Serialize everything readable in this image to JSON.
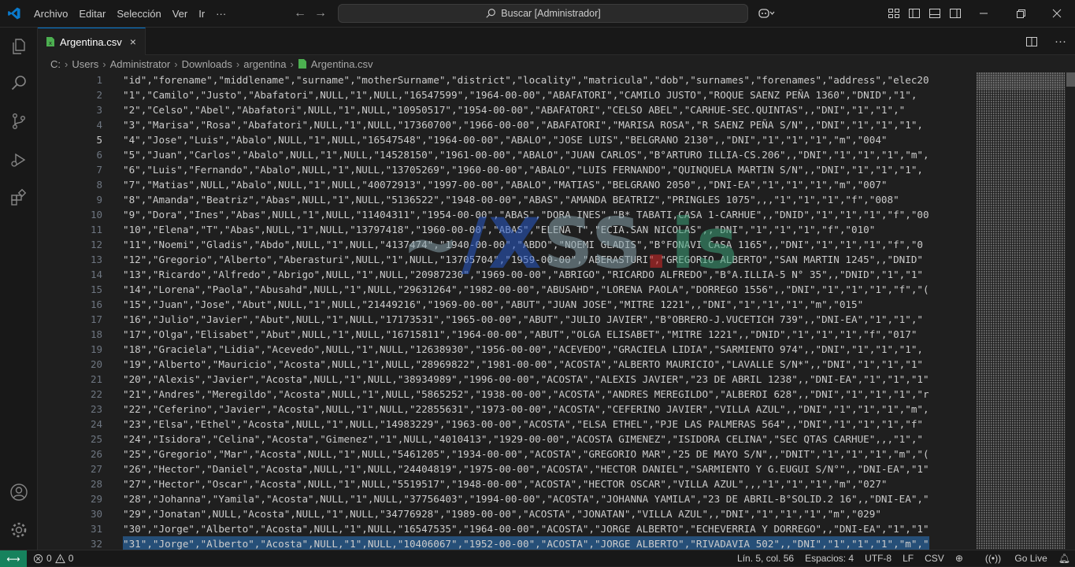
{
  "menu": [
    "Archivo",
    "Editar",
    "Selección",
    "Ver",
    "Ir",
    "···"
  ],
  "search_label": "Buscar [Administrador]",
  "tab_label": "Argentina.csv",
  "tab_close": "×",
  "breadcrumb": [
    "C:",
    "Users",
    "Administrator",
    "Downloads",
    "argentina",
    "Argentina.csv"
  ],
  "active_line": 5,
  "line_numbers": [
    "1",
    "2",
    "3",
    "4",
    "5",
    "6",
    "7",
    "8",
    "9",
    "10",
    "11",
    "12",
    "13",
    "14",
    "15",
    "16",
    "17",
    "18",
    "19",
    "20",
    "21",
    "22",
    "23",
    "24",
    "25",
    "26",
    "27",
    "28",
    "29",
    "30",
    "31",
    "32"
  ],
  "lines": [
    "\"id\",\"forename\",\"middlename\",\"surname\",\"motherSurname\",\"district\",\"locality\",\"matricula\",\"dob\",\"surnames\",\"forenames\",\"address\",\"elec20",
    "\"1\",\"Camilo\",\"Justo\",\"Abafatori\",NULL,\"1\",NULL,\"16547599\",\"1964-00-00\",\"ABAFATORI\",\"CAMILO JUSTO\",\"ROQUE SAENZ PEÑA 1360\",\"DNID\",\"1\",",
    "\"2\",\"Celso\",\"Abel\",\"Abafatori\",NULL,\"1\",NULL,\"10950517\",\"1954-00-00\",\"ABAFATORI\",\"CELSO ABEL\",\"CARHUE-SEC.QUINTAS\",,\"DNI\",\"1\",\"1\",\"",
    "\"3\",\"Marisa\",\"Rosa\",\"Abafatori\",NULL,\"1\",NULL,\"17360700\",\"1966-00-00\",\"ABAFATORI\",\"MARISA ROSA\",\"R SAENZ PEÑA S/N\",,\"DNI\",\"1\",\"1\",\"1\",",
    "\"4\",\"Jose\",\"Luis\",\"Abalo\",NULL,\"1\",NULL,\"16547548\",\"1964-00-00\",\"ABALO\",\"JOSE LUIS\",\"BELGRANO 2130\",,\"DNI\",\"1\",\"1\",\"1\",\"m\",\"004\"",
    "\"5\",\"Juan\",\"Carlos\",\"Abalo\",NULL,\"1\",NULL,\"14528150\",\"1961-00-00\",\"ABALO\",\"JUAN CARLOS\",\"B°ARTURO ILLIA-CS.206\",,\"DNI\",\"1\",\"1\",\"1\",\"m\",",
    "\"6\",\"Luis\",\"Fernando\",\"Abalo\",NULL,\"1\",NULL,\"13705269\",\"1960-00-00\",\"ABALO\",\"LUIS FERNANDO\",\"QUINQUELA MARTIN S/N\",,\"DNI\",\"1\",\"1\",\"1\",",
    "\"7\",\"Matias\",NULL,\"Abalo\",NULL,\"1\",NULL,\"40072913\",\"1997-00-00\",\"ABALO\",\"MATIAS\",\"BELGRANO 2050\",,\"DNI-EA\",\"1\",\"1\",\"1\",\"m\",\"007\"",
    "\"8\",\"Amanda\",\"Beatriz\",\"Abas\",NULL,\"1\",NULL,\"5136522\",\"1948-00-00\",\"ABAS\",\"AMANDA BEATRIZ\",\"PRINGLES 1075\",,,\"1\",\"1\",\"1\",\"f\",\"008\"",
    "\"9\",\"Dora\",\"Ines\",\"Abas\",NULL,\"1\",NULL,\"11404311\",\"1954-00-00\",\"ABAS\",\"DORA INES\",\"B* TABATI,CASA 1-CARHUE\",,\"DNID\",\"1\",\"1\",\"1\",\"f\",\"00",
    "\"10\",\"Elena\",\"T\",\"Abas\",NULL,\"1\",NULL,\"13797418\",\"1960-00-00\",\"ABAS\",\"ELENA T\",\"ECIA.SAN NICOLAS\",,\"DNI\",\"1\",\"1\",\"1\",\"f\",\"010\"",
    "\"11\",\"Noemi\",\"Gladis\",\"Abdo\",NULL,\"1\",NULL,\"4137474\",\"1940-00-00\",\"ABDO\",\"NOEMI GLADIS\",\"B°FONAVI CASA 1165\",,\"DNI\",\"1\",\"1\",\"1\",\"f\",\"0",
    "\"12\",\"Gregorio\",\"Alberto\",\"Aberasturi\",NULL,\"1\",NULL,\"13705704\",\"1959-00-00\",\"ABERASTURI\",\"GREGORIO ALBERTO\",\"SAN MARTIN 1245\",,\"DNID\"",
    "\"13\",\"Ricardo\",\"Alfredo\",\"Abrigo\",NULL,\"1\",NULL,\"20987230\",\"1969-00-00\",\"ABRIGO\",\"RICARDO ALFREDO\",\"B°A.ILLIA-5 N° 35\",,\"DNID\",\"1\",\"1\"",
    "\"14\",\"Lorena\",\"Paola\",\"Abusahd\",NULL,\"1\",NULL,\"29631264\",\"1982-00-00\",\"ABUSAHD\",\"LORENA PAOLA\",\"DORREGO 1556\",,\"DNI\",\"1\",\"1\",\"1\",\"f\",\"(",
    "\"15\",\"Juan\",\"Jose\",\"Abut\",NULL,\"1\",NULL,\"21449216\",\"1969-00-00\",\"ABUT\",\"JUAN JOSE\",\"MITRE 1221\",,\"DNI\",\"1\",\"1\",\"1\",\"m\",\"015\"",
    "\"16\",\"Julio\",\"Javier\",\"Abut\",NULL,\"1\",NULL,\"17173531\",\"1965-00-00\",\"ABUT\",\"JULIO JAVIER\",\"B°OBRERO-J.VUCETICH 739\",,\"DNI-EA\",\"1\",\"1\",\"",
    "\"17\",\"Olga\",\"Elisabet\",\"Abut\",NULL,\"1\",NULL,\"16715811\",\"1964-00-00\",\"ABUT\",\"OLGA ELISABET\",\"MITRE 1221\",,\"DNID\",\"1\",\"1\",\"1\",\"f\",\"017\"",
    "\"18\",\"Graciela\",\"Lidia\",\"Acevedo\",NULL,\"1\",NULL,\"12638930\",\"1956-00-00\",\"ACEVEDO\",\"GRACIELA LIDIA\",\"SARMIENTO 974\",,\"DNI\",\"1\",\"1\",\"1\",",
    "\"19\",\"Alberto\",\"Mauricio\",\"Acosta\",NULL,\"1\",NULL,\"28969822\",\"1981-00-00\",\"ACOSTA\",\"ALBERTO MAURICIO\",\"LAVALLE S/N*\",,\"DNI\",\"1\",\"1\",\"1\"",
    "\"20\",\"Alexis\",\"Javier\",\"Acosta\",NULL,\"1\",NULL,\"38934989\",\"1996-00-00\",\"ACOSTA\",\"ALEXIS JAVIER\",\"23 DE ABRIL 1238\",,\"DNI-EA\",\"1\",\"1\",\"1\"",
    "\"21\",\"Andres\",\"Meregildo\",\"Acosta\",NULL,\"1\",NULL,\"5865252\",\"1938-00-00\",\"ACOSTA\",\"ANDRES MEREGILDO\",\"ALBERDI 628\",,\"DNI\",\"1\",\"1\",\"1\",\"r",
    "\"22\",\"Ceferino\",\"Javier\",\"Acosta\",NULL,\"1\",NULL,\"22855631\",\"1973-00-00\",\"ACOSTA\",\"CEFERINO JAVIER\",\"VILLA AZUL\",,\"DNI\",\"1\",\"1\",\"1\",\"m\",",
    "\"23\",\"Elsa\",\"Ethel\",\"Acosta\",NULL,\"1\",NULL,\"14983229\",\"1963-00-00\",\"ACOSTA\",\"ELSA ETHEL\",\"PJE LAS PALMERAS 564\",,\"DNI\",\"1\",\"1\",\"1\",\"f\"",
    "\"24\",\"Isidora\",\"Celina\",\"Acosta\",\"Gimenez\",\"1\",NULL,\"4010413\",\"1929-00-00\",\"ACOSTA GIMENEZ\",\"ISIDORA CELINA\",\"SEC QTAS CARHUE\",,,\"1\",\"",
    "\"25\",\"Gregorio\",\"Mar\",\"Acosta\",NULL,\"1\",NULL,\"5461205\",\"1934-00-00\",\"ACOSTA\",\"GREGORIO MAR\",\"25 DE MAYO S/N\",,\"DNIT\",\"1\",\"1\",\"1\",\"m\",\"(",
    "\"26\",\"Hector\",\"Daniel\",\"Acosta\",NULL,\"1\",NULL,\"24404819\",\"1975-00-00\",\"ACOSTA\",\"HECTOR DANIEL\",\"SARMIENTO Y G.EUGUI S/N°\",,\"DNI-EA\",\"1\"",
    "\"27\",\"Hector\",\"Oscar\",\"Acosta\",NULL,\"1\",NULL,\"5519517\",\"1948-00-00\",\"ACOSTA\",\"HECTOR OSCAR\",\"VILLA AZUL\",,,\"1\",\"1\",\"1\",\"m\",\"027\"",
    "\"28\",\"Johanna\",\"Yamila\",\"Acosta\",NULL,\"1\",NULL,\"37756403\",\"1994-00-00\",\"ACOSTA\",\"JOHANNA YAMILA\",\"23 DE ABRIL-B°SOLID.2 16\",,\"DNI-EA\",\"",
    "\"29\",\"Jonatan\",NULL,\"Acosta\",NULL,\"1\",NULL,\"34776928\",\"1989-00-00\",\"ACOSTA\",\"JONATAN\",\"VILLA AZUL\",,\"DNI\",\"1\",\"1\",\"1\",\"m\",\"029\"",
    "\"30\",\"Jorge\",\"Alberto\",\"Acosta\",NULL,\"1\",NULL,\"16547535\",\"1964-00-00\",\"ACOSTA\",\"JORGE ALBERTO\",\"ECHEVERRIA Y DORREGO\",,\"DNI-EA\",\"1\",\"1\"",
    "\"31\",\"Jorge\",\"Alberto\",\"Acosta\",NULL,\"1\",NULL,\"10406067\",\"1952-00-00\",\"ACOSTA\",\"JORGE ALBERTO\",\"RIVADAVIA 502\",,\"DNI\",\"1\",\"1\",\"1\",\"m\",\""
  ],
  "watermark": {
    "prefix": "~",
    "slash": "/",
    "x": "X",
    "ss": "SS",
    "dot": ".",
    "is": "is"
  },
  "status": {
    "remote": "⟷",
    "errors": "0",
    "warnings": "0",
    "position": "Lín. 5, col. 56",
    "spaces": "Espacios: 4",
    "encoding": "UTF-8",
    "eol": "LF",
    "language": "CSV",
    "golive": "Go Live"
  },
  "colors": {
    "accent": "#0078d4",
    "remote_bg": "#16825d",
    "file_icon": "#4caf50",
    "vscode_logo": "#0a7acc"
  }
}
